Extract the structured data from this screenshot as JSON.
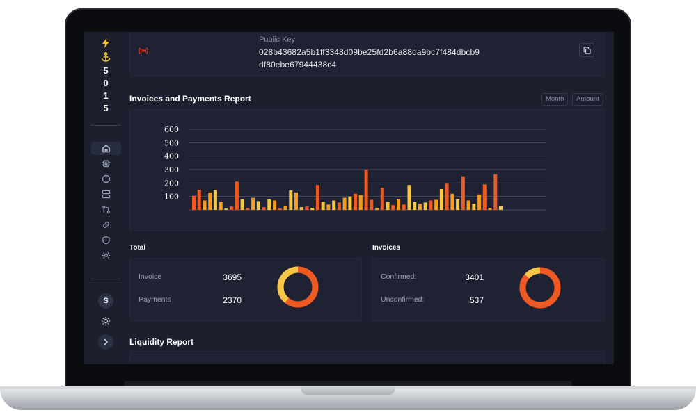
{
  "sidebar": {
    "digits": [
      "5",
      "0",
      "1",
      "5"
    ],
    "avatar_letter": "S",
    "colors": {
      "bolt": "#f7c325",
      "anchor": "#f7c325",
      "icon": "#9aa0b2"
    },
    "nav_icons": [
      "home-icon",
      "chip-icon",
      "crosshair-icon",
      "server-icon",
      "git-compare-icon",
      "link-icon",
      "shield-icon",
      "settings-icon"
    ]
  },
  "public_key": {
    "label": "Public Key",
    "value": "028b43682a5b1ff3348d09be25fd2b6a88da9bc7f484dbcb9df80ebe67944438c4"
  },
  "report": {
    "title": "Invoices and Payments Report",
    "buttons": [
      "Month",
      "Amount"
    ]
  },
  "chart_data": {
    "type": "bar",
    "ylim": [
      0,
      600
    ],
    "yticks": [
      100,
      200,
      300,
      400,
      500,
      600
    ],
    "grid": true,
    "colors": {
      "a": "#f6c744",
      "b": "#ef5a24",
      "c": "#f59c1f"
    },
    "values": [
      105,
      150,
      70,
      130,
      150,
      60,
      10,
      25,
      210,
      80,
      15,
      90,
      65,
      20,
      80,
      70,
      10,
      30,
      145,
      130,
      20,
      25,
      15,
      185,
      60,
      40,
      70,
      55,
      90,
      100,
      120,
      110,
      300,
      75,
      15,
      165,
      60,
      35,
      80,
      40,
      185,
      60,
      45,
      55,
      70,
      75,
      155,
      195,
      120,
      80,
      250,
      70,
      45,
      115,
      190,
      15,
      265,
      30
    ],
    "color_keys": [
      "b",
      "b",
      "c",
      "c",
      "a",
      "c",
      "a",
      "b",
      "b",
      "a",
      "b",
      "c",
      "a",
      "b",
      "a",
      "c",
      "b",
      "c",
      "a",
      "c",
      "a",
      "b",
      "a",
      "b",
      "a",
      "c",
      "a",
      "b",
      "c",
      "a",
      "b",
      "c",
      "b",
      "b",
      "c",
      "b",
      "a",
      "b",
      "c",
      "b",
      "a",
      "a",
      "c",
      "a",
      "b",
      "c",
      "a",
      "b",
      "c",
      "a",
      "b",
      "c",
      "a",
      "c",
      "b",
      "c",
      "b",
      "a"
    ]
  },
  "total": {
    "title": "Total",
    "rows": [
      {
        "label": "Invoice",
        "value": "3695"
      },
      {
        "label": "Payments",
        "value": "2370"
      }
    ],
    "donut": {
      "share": 0.39,
      "color_a": "#f6c744",
      "color_b": "#ef5a24"
    }
  },
  "invoices": {
    "title": "Invoices",
    "rows": [
      {
        "label": "Confirmed:",
        "value": "3401"
      },
      {
        "label": "Unconfirmed:",
        "value": "537"
      }
    ],
    "donut": {
      "share": 0.136,
      "color_a": "#f6c744",
      "color_b": "#ef5a24"
    }
  },
  "liquidity": {
    "title": "Liquidity Report"
  }
}
